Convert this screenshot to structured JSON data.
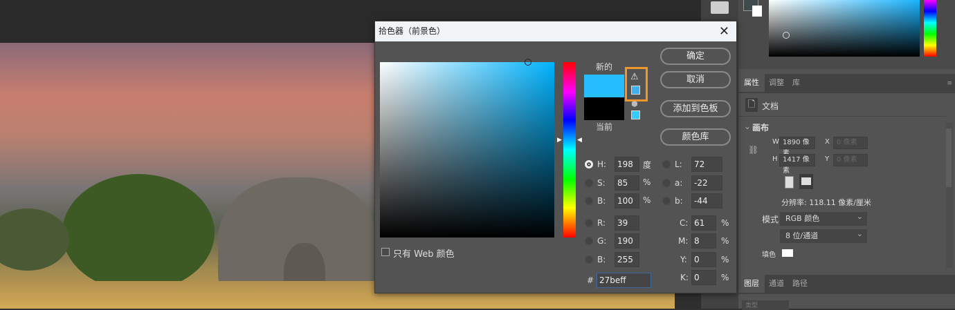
{
  "dialog": {
    "title": "拾色器（前景色）",
    "new_label": "新的",
    "current_label": "当前",
    "new_color": "#27beff",
    "current_color": "#000000",
    "buttons": {
      "ok": "确定",
      "cancel": "取消",
      "add_swatch": "添加到色板",
      "libraries": "颜色库"
    },
    "web_only": "只有 Web 颜色",
    "hsb": [
      {
        "label": "H:",
        "value": "198",
        "unit": "度",
        "selected": true
      },
      {
        "label": "S:",
        "value": "85",
        "unit": "%"
      },
      {
        "label": "B:",
        "value": "100",
        "unit": "%"
      }
    ],
    "lab": [
      {
        "label": "L:",
        "value": "72"
      },
      {
        "label": "a:",
        "value": "-22"
      },
      {
        "label": "b:",
        "value": "-44"
      }
    ],
    "rgb": [
      {
        "label": "R:",
        "value": "39"
      },
      {
        "label": "G:",
        "value": "190"
      },
      {
        "label": "B:",
        "value": "255"
      }
    ],
    "cmyk": [
      {
        "label": "C:",
        "value": "61",
        "unit": "%"
      },
      {
        "label": "M:",
        "value": "8",
        "unit": "%"
      },
      {
        "label": "Y:",
        "value": "0",
        "unit": "%"
      },
      {
        "label": "K:",
        "value": "0",
        "unit": "%"
      }
    ],
    "hex_label": "#",
    "hex": "27beff",
    "highlight_color": "#f0962a"
  },
  "properties": {
    "tabs": [
      "属性",
      "调整",
      "库"
    ],
    "doc_label": "文档",
    "section": "画布",
    "w_label": "W",
    "w_value": "1890 像素",
    "h_label": "H",
    "h_value": "1417 像素",
    "x_label": "X",
    "x_value": "0 像素",
    "y_label": "Y",
    "y_value": "0 像素",
    "resolution": "分辨率: 118.11 像素/厘米",
    "mode_label": "模式",
    "mode_value": "RGB 颜色",
    "depth_value": "8 位/通道",
    "fill_label": "填色"
  },
  "layers": {
    "tabs": [
      "图层",
      "通道",
      "路径"
    ],
    "search_placeholder": "类型"
  }
}
